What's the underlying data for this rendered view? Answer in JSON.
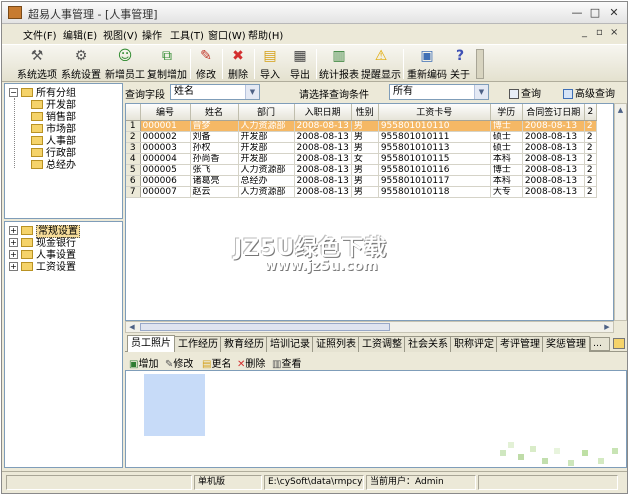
{
  "window": {
    "title": "超易人事管理 - [人事管理]",
    "minimize": "—",
    "maximize": "□",
    "close": "✕"
  },
  "menu": {
    "items": [
      "文件(F)",
      "编辑(E)",
      "视图(V)",
      "操作",
      "工具(T)",
      "窗口(W)",
      "帮助(H)"
    ],
    "child_controls": [
      "_",
      "▫",
      "×"
    ]
  },
  "toolbar": {
    "buttons": [
      {
        "label": "系统选项",
        "icon": "wrench-screwdriver-icon",
        "glyph": "⚒",
        "color": "#555555"
      },
      {
        "label": "系统设置",
        "icon": "tools-icon",
        "glyph": "⚙",
        "color": "#555555"
      },
      {
        "label": "新增员工",
        "icon": "add-user-icon",
        "glyph": "☺",
        "color": "#2f8a2f"
      },
      {
        "label": "复制增加",
        "icon": "copy-add-icon",
        "glyph": "⧉",
        "color": "#2f8a2f"
      },
      {
        "label": "修改",
        "icon": "pencil-icon",
        "glyph": "✎",
        "color": "#c0392b"
      },
      {
        "label": "删除",
        "icon": "delete-x-icon",
        "glyph": "✖",
        "color": "#d32f2f"
      },
      {
        "label": "导入",
        "icon": "import-folder-icon",
        "glyph": "▤",
        "color": "#d4a017"
      },
      {
        "label": "导出",
        "icon": "printer-export-icon",
        "glyph": "▦",
        "color": "#444444"
      },
      {
        "label": "统计报表",
        "icon": "bar-chart-icon",
        "glyph": "▥",
        "color": "#2e7d32"
      },
      {
        "label": "提醒显示",
        "icon": "warning-icon",
        "glyph": "⚠",
        "color": "#e0a800"
      },
      {
        "label": "重新编码",
        "icon": "recode-window-icon",
        "glyph": "▣",
        "color": "#3f6fb5"
      },
      {
        "label": "关于",
        "icon": "help-question-icon",
        "glyph": "?",
        "color": "#3f51b5"
      }
    ]
  },
  "tree_departments": {
    "root": "所有分组",
    "children": [
      "开发部",
      "销售部",
      "市场部",
      "人事部",
      "行政部",
      "总经办"
    ]
  },
  "tree_settings": {
    "items": [
      "常规设置",
      "现金银行",
      "人事设置",
      "工资设置"
    ],
    "selected": "常规设置"
  },
  "query": {
    "field_label": "查询字段",
    "field_value": "姓名",
    "condition_label": "请选择查询条件",
    "condition_value": "所有",
    "search_button": "查询",
    "advanced_button": "高级查询"
  },
  "grid": {
    "columns": [
      "编号",
      "姓名",
      "部门",
      "入职日期",
      "性别",
      "工资卡号",
      "学历",
      "合同签订日期",
      "2"
    ],
    "rows": [
      {
        "n": "1",
        "cells": [
          "000001",
          "曾梦",
          "人力资源部",
          "2008-08-13",
          "男",
          "955801010110",
          "博士",
          "2008-08-13",
          "2"
        ],
        "selected": true
      },
      {
        "n": "2",
        "cells": [
          "000002",
          "刘备",
          "开发部",
          "2008-08-13",
          "男",
          "955801010111",
          "硕士",
          "2008-08-13",
          "2"
        ],
        "selected": false
      },
      {
        "n": "3",
        "cells": [
          "000003",
          "孙权",
          "开发部",
          "2008-08-13",
          "男",
          "955801010113",
          "硕士",
          "2008-08-13",
          "2"
        ],
        "selected": false
      },
      {
        "n": "4",
        "cells": [
          "000004",
          "孙尚香",
          "开发部",
          "2008-08-13",
          "女",
          "955801010115",
          "本科",
          "2008-08-13",
          "2"
        ],
        "selected": false
      },
      {
        "n": "5",
        "cells": [
          "000005",
          "张飞",
          "人力资源部",
          "2008-08-13",
          "男",
          "955801010116",
          "博士",
          "2008-08-13",
          "2"
        ],
        "selected": false
      },
      {
        "n": "6",
        "cells": [
          "000006",
          "诸葛亮",
          "总经办",
          "2008-08-13",
          "男",
          "955801010117",
          "本科",
          "2008-08-13",
          "2"
        ],
        "selected": false
      },
      {
        "n": "7",
        "cells": [
          "000007",
          "赵云",
          "人力资源部",
          "2008-08-13",
          "男",
          "955801010118",
          "大专",
          "2008-08-13",
          "2"
        ],
        "selected": false
      }
    ]
  },
  "tabs": {
    "items": [
      "员工照片",
      "工作经历",
      "教育经历",
      "培训记录",
      "证照列表",
      "工资调整",
      "社会关系",
      "职称评定",
      "考评管理",
      "奖惩管理"
    ],
    "active": "员工照片"
  },
  "photo_toolbar": {
    "buttons": [
      "增加",
      "修改",
      "更名",
      "删除",
      "查看"
    ]
  },
  "statusbar": {
    "mode": "单机版",
    "db_path": "E:\\cySoft\\data\\rmpcyeic.sys",
    "user": "当前用户：Admin"
  },
  "watermark": {
    "line1": "JZ5U绿色下载",
    "line2": "www.jz5u.com"
  }
}
